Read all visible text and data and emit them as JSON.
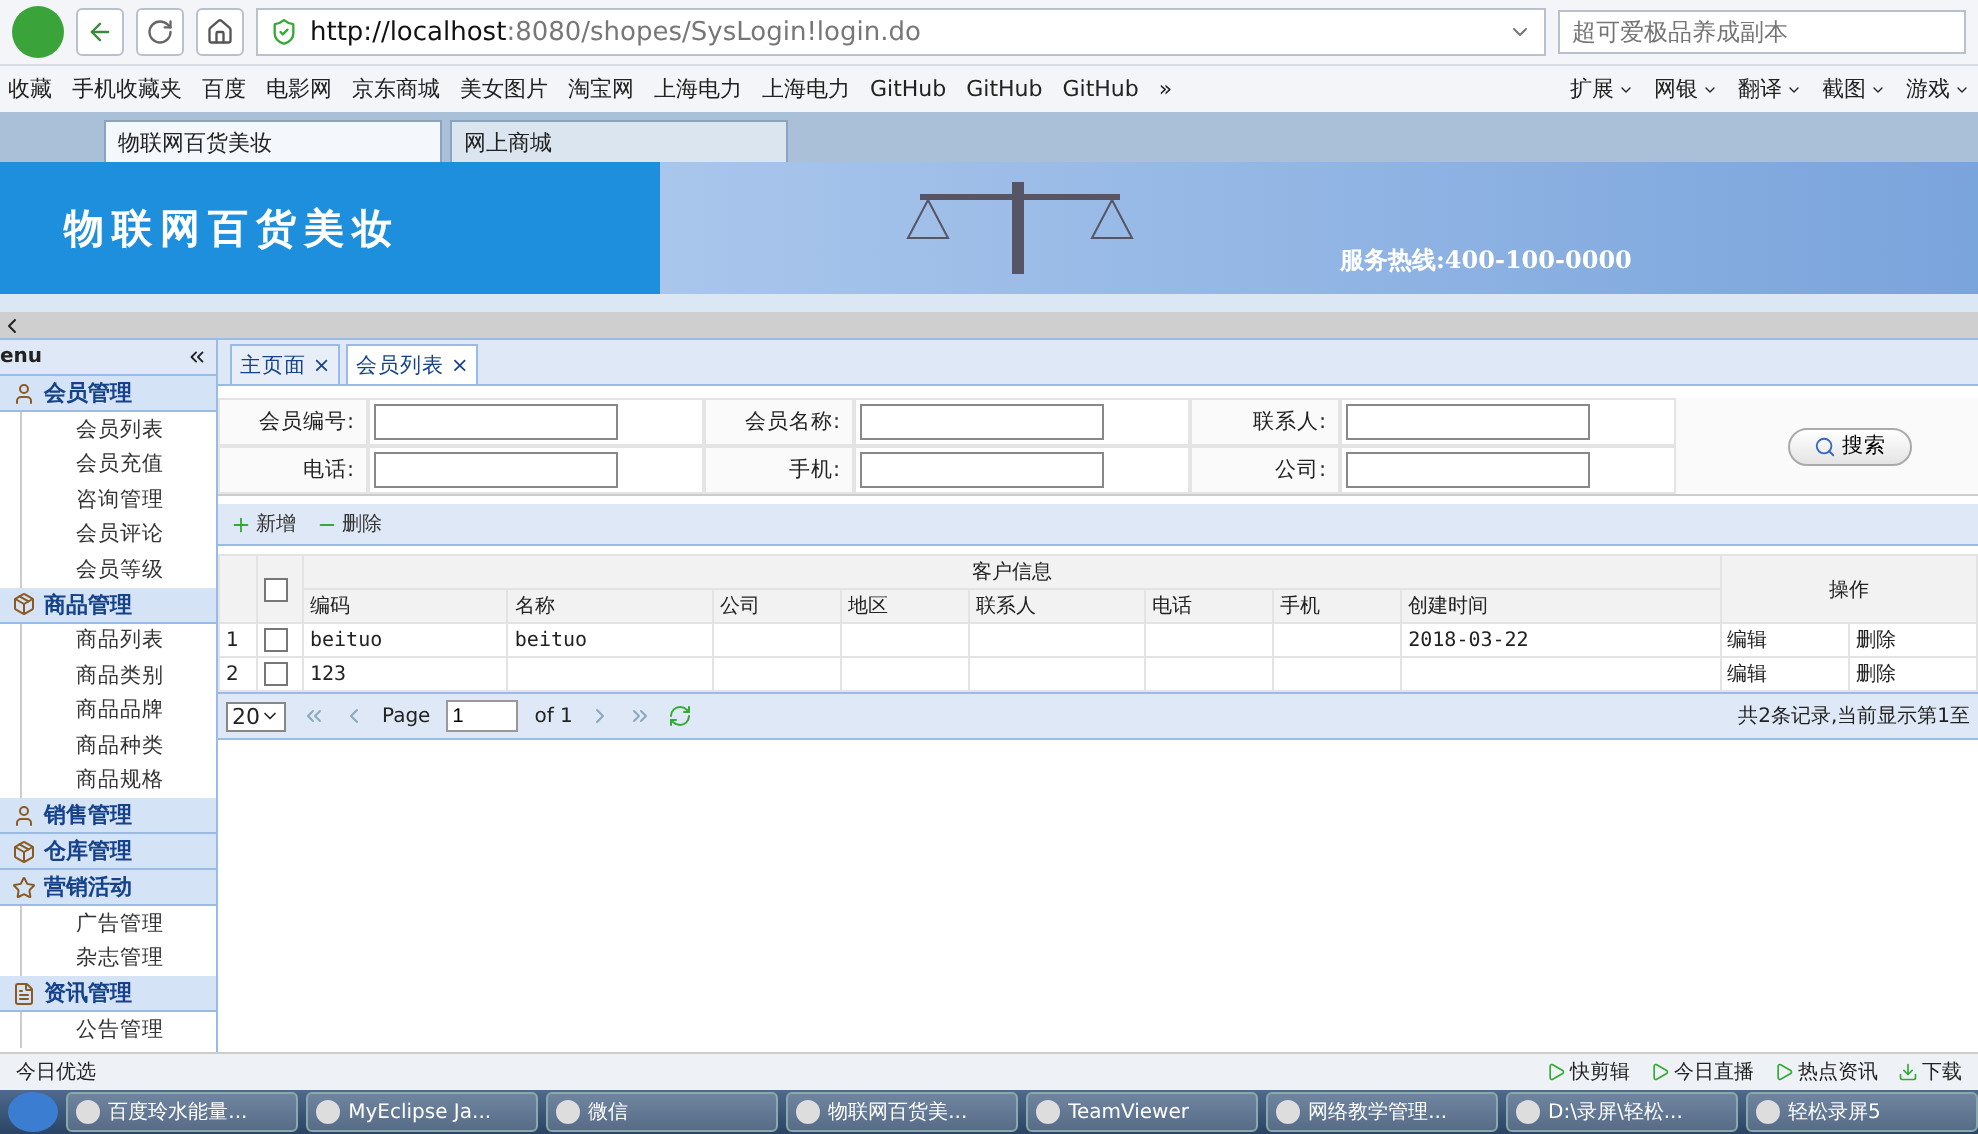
{
  "browser": {
    "url_host": "http://localhost",
    "url_rest": ":8080/shopes/SysLogin!login.do",
    "search_placeholder": "超可爱极品养成副本",
    "bookmarks": [
      "收藏",
      "手机收藏夹",
      "百度",
      "电影网",
      "京东商城",
      "美女图片",
      "淘宝网",
      "上海电力",
      "上海电力",
      "GitHub",
      "GitHub",
      "GitHub",
      "»"
    ],
    "tools": [
      "扩展",
      "网银",
      "翻译",
      "截图",
      "游戏"
    ],
    "tabs": [
      {
        "label": "物联网百货美妆",
        "selected": true
      },
      {
        "label": "网上商城",
        "selected": false
      }
    ]
  },
  "header": {
    "title": "物联网百货美妆",
    "hotline": "服务热线:400-100-0000"
  },
  "sidebar": {
    "title": "enu",
    "groups": [
      {
        "label": "会员管理",
        "children": [
          {
            "label": "会员列表"
          },
          {
            "label": "会员充值"
          },
          {
            "label": "咨询管理"
          },
          {
            "label": "会员评论"
          },
          {
            "label": "会员等级"
          }
        ]
      },
      {
        "label": "商品管理",
        "children": [
          {
            "label": "商品列表"
          },
          {
            "label": "商品类别"
          },
          {
            "label": "商品品牌"
          },
          {
            "label": "商品种类"
          },
          {
            "label": "商品规格"
          }
        ]
      },
      {
        "label": "销售管理"
      },
      {
        "label": "仓库管理"
      },
      {
        "label": "营销活动",
        "children": [
          {
            "label": "广告管理"
          },
          {
            "label": "杂志管理"
          }
        ]
      },
      {
        "label": "资讯管理",
        "children": [
          {
            "label": "公告管理"
          }
        ]
      }
    ]
  },
  "tabs": [
    {
      "label": "主页面",
      "close": "×",
      "selected": false
    },
    {
      "label": "会员列表",
      "close": "×",
      "selected": true
    }
  ],
  "filters": [
    [
      {
        "label": "会员编号:"
      },
      {
        "label": "会员名称:"
      },
      {
        "label": "联系人:"
      }
    ],
    [
      {
        "label": "电话:"
      },
      {
        "label": "手机:"
      },
      {
        "label": "公司:"
      }
    ]
  ],
  "search_button": "搜索",
  "toolbar": [
    "新增",
    "删除"
  ],
  "table": {
    "group_header": "客户信息",
    "columns": [
      "编码",
      "名称",
      "公司",
      "地区",
      "联系人",
      "电话",
      "手机",
      "创建时间"
    ],
    "actions_header": "操作",
    "select_all_checked": false,
    "rows": [
      {
        "index": "1",
        "checked": false,
        "cells": [
          "beituo",
          "beituo",
          "",
          "",
          "",
          "",
          "",
          "2018-03-22"
        ],
        "actions": [
          "编辑",
          "删除"
        ]
      },
      {
        "index": "2",
        "checked": false,
        "cells": [
          "123",
          "",
          "",
          "",
          "",
          "",
          "",
          ""
        ],
        "actions": [
          "编辑",
          "删除"
        ]
      }
    ]
  },
  "pager": {
    "page_size": "20",
    "page_label": "Page",
    "page": "1",
    "of": "of 1",
    "summary": "共2条记录,当前显示第1至"
  },
  "status_bar": {
    "left": "今日优选",
    "right": [
      "快剪辑",
      "今日直播",
      "热点资讯",
      "下载"
    ]
  },
  "taskbar": [
    "百度玲水能量...",
    "MyEclipse Ja...",
    "微信",
    "物联网百货美...",
    "TeamViewer",
    "网络教学管理...",
    "D:\\录屏\\轻松...",
    "轻松录屏5"
  ]
}
